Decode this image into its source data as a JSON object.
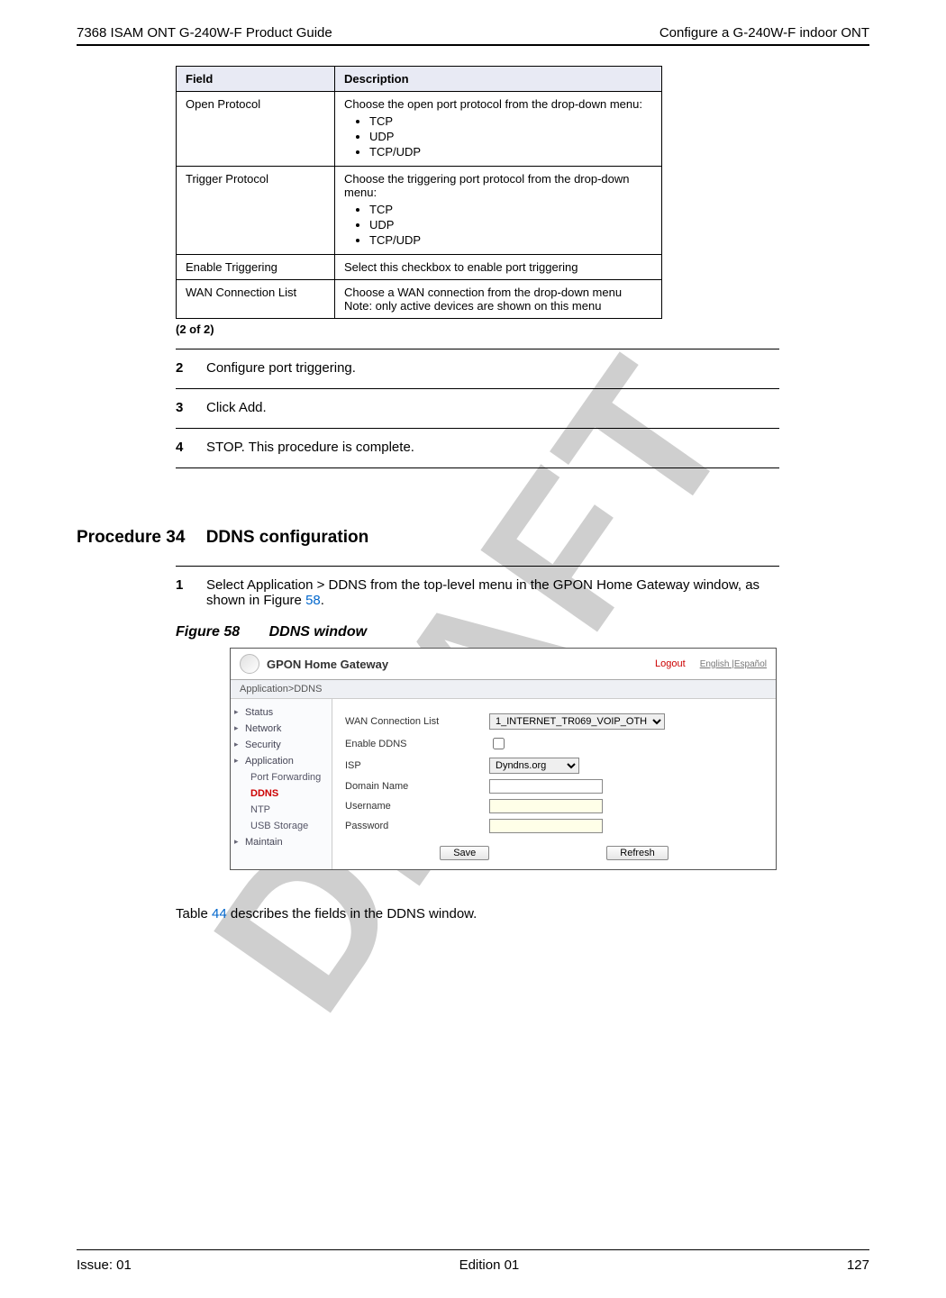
{
  "header": {
    "left": "7368 ISAM ONT G-240W-F Product Guide",
    "right": "Configure a G-240W-F indoor ONT"
  },
  "watermark": "DRAFT",
  "table": {
    "col_field": "Field",
    "col_desc": "Description",
    "rows": [
      {
        "field": "Open Protocol",
        "desc_intro": "Choose the open port protocol from the drop-down menu:",
        "bullets": [
          "TCP",
          "UDP",
          "TCP/UDP"
        ]
      },
      {
        "field": "Trigger Protocol",
        "desc_intro": "Choose the triggering port protocol from the drop-down menu:",
        "bullets": [
          "TCP",
          "UDP",
          "TCP/UDP"
        ]
      },
      {
        "field": "Enable Triggering",
        "desc_intro": "Select this checkbox to enable port triggering",
        "bullets": []
      },
      {
        "field": "WAN Connection List",
        "desc_intro": "Choose a WAN connection from the drop-down menu",
        "note": "Note: only active devices are shown on this menu",
        "bullets": []
      }
    ],
    "footer": "(2 of 2)"
  },
  "steps": [
    {
      "num": "2",
      "text": "Configure port triggering."
    },
    {
      "num": "3",
      "text": "Click Add."
    },
    {
      "num": "4",
      "text": "STOP. This procedure is complete."
    }
  ],
  "procedure": {
    "label": "Procedure 34",
    "title": "DDNS configuration"
  },
  "step1": {
    "num": "1",
    "text_a": "Select Application > DDNS from the top-level menu in the GPON Home Gateway window, as shown in Figure ",
    "link": "58",
    "text_b": "."
  },
  "figure": {
    "label": "Figure 58",
    "title": "DDNS window"
  },
  "screenshot": {
    "title": "GPON Home Gateway",
    "logout": "Logout",
    "langs": "English |Español",
    "breadcrumb": "Application>DDNS",
    "side_nav": {
      "status": "Status",
      "network": "Network",
      "security": "Security",
      "application": "Application",
      "port_forwarding": "Port Forwarding",
      "ddns": "DDNS",
      "ntp": "NTP",
      "usb_storage": "USB Storage",
      "maintain": "Maintain"
    },
    "form": {
      "wan_label": "WAN Connection List",
      "wan_value": "1_INTERNET_TR069_VOIP_OTH",
      "enable_label": "Enable DDNS",
      "isp_label": "ISP",
      "isp_value": "Dyndns.org",
      "domain_label": "Domain Name",
      "user_label": "Username",
      "pass_label": "Password",
      "save_btn": "Save",
      "refresh_btn": "Refresh"
    }
  },
  "after_figure": {
    "text_a": "Table ",
    "link": "44",
    "text_b": " describes the fields in the DDNS window."
  },
  "footer": {
    "left": "Issue: 01",
    "center": "Edition 01",
    "right": "127"
  }
}
